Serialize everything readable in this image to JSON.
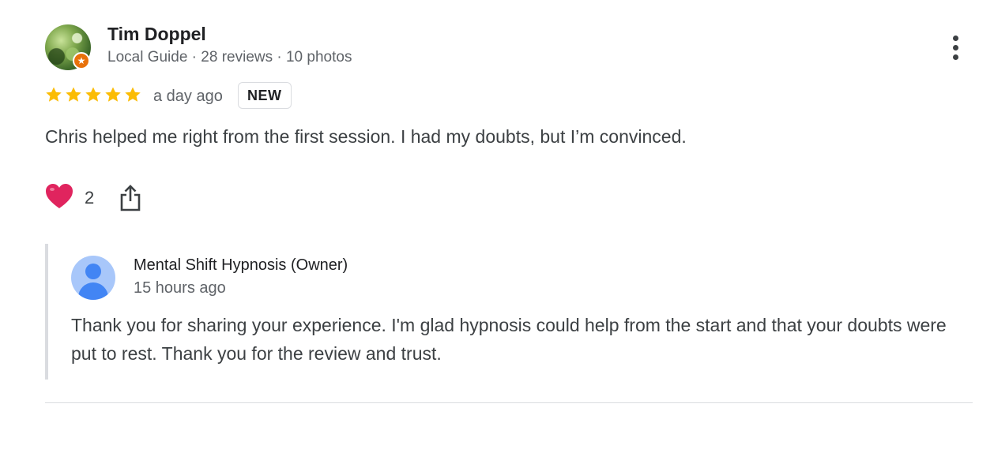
{
  "reviewer": {
    "name": "Tim Doppel",
    "meta": "Local Guide · 28 reviews · 10 photos",
    "badge_icon": "★"
  },
  "rating": {
    "stars": 5,
    "max": 5,
    "color": "#fbbc04"
  },
  "review": {
    "time": "a day ago",
    "badge": "NEW",
    "text": "Chris helped me right from the first session. I had my doubts, but I’m convinced."
  },
  "actions": {
    "like_icon": "heart-icon",
    "like_count": "2",
    "share_icon": "share-icon"
  },
  "owner_reply": {
    "name": "Mental Shift Hypnosis (Owner)",
    "time": "15 hours ago",
    "text": "Thank you for sharing your experience. I'm glad hypnosis could help from the start and that your doubts were put to rest. Thank you for the review and trust."
  },
  "colors": {
    "heart": "#e0245e",
    "guide_badge": "#e8710a",
    "owner_avatar_bg": "#a8c7fa",
    "owner_avatar_fg": "#4285f4"
  }
}
